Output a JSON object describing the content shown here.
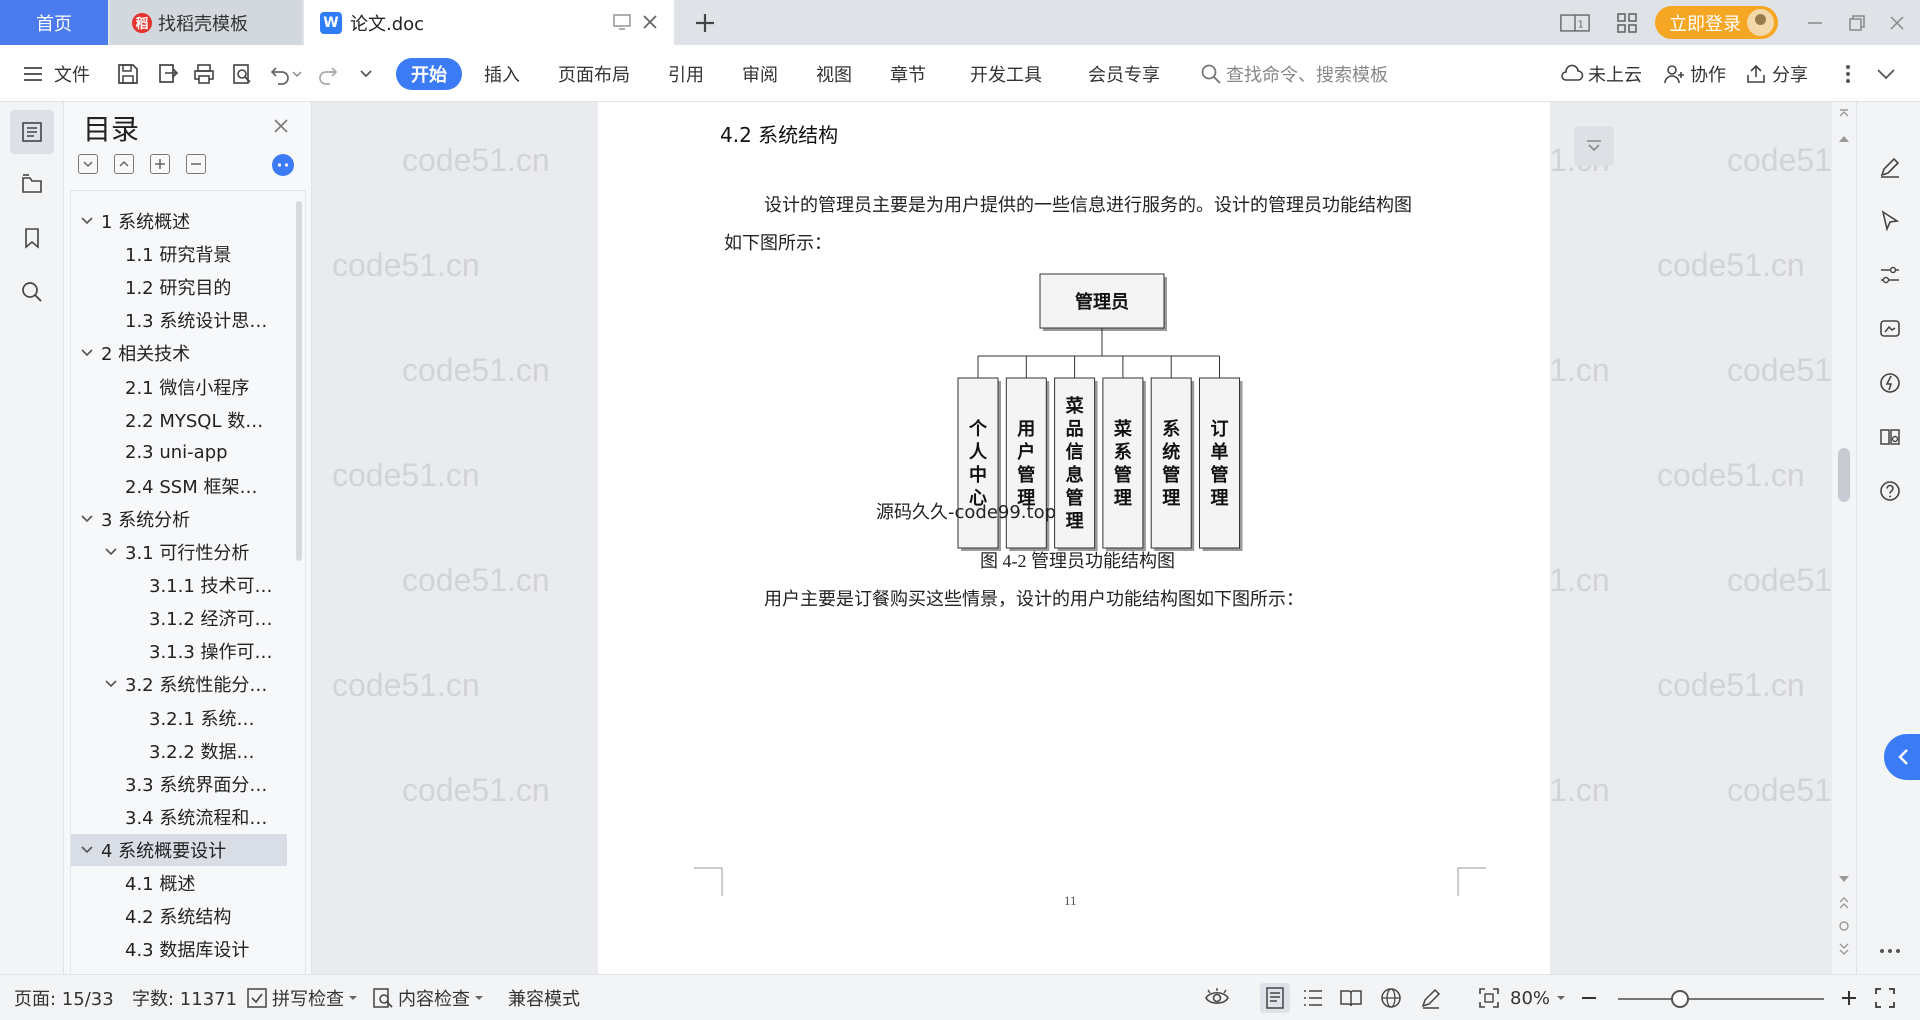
{
  "tabs": {
    "home": "首页",
    "template": "找稻壳模板",
    "doc": "论文.doc",
    "login": "立即登录"
  },
  "ribbon": {
    "file": "文件",
    "tabs": [
      "开始",
      "插入",
      "页面布局",
      "引用",
      "审阅",
      "视图",
      "章节",
      "开发工具",
      "会员专享"
    ],
    "search_placeholder": "查找命令、搜索模板",
    "cloud": "未上云",
    "collab": "协作",
    "share": "分享"
  },
  "toc": {
    "title": "目录",
    "items": [
      {
        "label": "1 系统概述",
        "level": 1,
        "expanded": true
      },
      {
        "label": "1.1  研究背景",
        "level": 2
      },
      {
        "label": "1.2 研究目的",
        "level": 2
      },
      {
        "label": "1.3 系统设计思…",
        "level": 2
      },
      {
        "label": "2 相关技术",
        "level": 1,
        "expanded": true
      },
      {
        "label": "2.1 微信小程序",
        "level": 2
      },
      {
        "label": "2.2 MYSQL 数…",
        "level": 2
      },
      {
        "label": "2.3 uni-app",
        "level": 2
      },
      {
        "label": "2.4 SSM 框架…",
        "level": 2
      },
      {
        "label": "3 系统分析",
        "level": 1,
        "expanded": true
      },
      {
        "label": "3.1 可行性分析",
        "level": 2,
        "expanded": true
      },
      {
        "label": "3.1.1 技术可…",
        "level": 3
      },
      {
        "label": "3.1.2 经济可…",
        "level": 3
      },
      {
        "label": "3.1.3 操作可…",
        "level": 3
      },
      {
        "label": "3.2 系统性能分…",
        "level": 2,
        "expanded": true
      },
      {
        "label": "3.2.1  系统…",
        "level": 3
      },
      {
        "label": "3.2.2  数据…",
        "level": 3
      },
      {
        "label": "3.3 系统界面分…",
        "level": 2
      },
      {
        "label": "3.4 系统流程和…",
        "level": 2
      },
      {
        "label": "4 系统概要设计",
        "level": 1,
        "expanded": true,
        "selected": true
      },
      {
        "label": "4.1 概述",
        "level": 2
      },
      {
        "label": "4.2 系统结构",
        "level": 2
      },
      {
        "label": "4.3 数据库设计",
        "level": 2
      }
    ]
  },
  "document": {
    "heading": "4.2 系统结构",
    "para1_line1": "设计的管理员主要是为用户提供的一些信息进行服务的。设计的管理员功能结构图",
    "para1_line2": "如下图所示：",
    "diagram_root": "管理员",
    "diagram_children": [
      "个人中心",
      "用户管理",
      "菜品信息管理",
      "菜系管理",
      "系统管理",
      "订单管理"
    ],
    "overlay_text": "源码久久-code99.top",
    "figure_caption": "图 4-2 管理员功能结构图",
    "para2": "用户主要是订餐购买这些情景，设计的用户功能结构图如下图所示：",
    "page_number": "11",
    "watermark": "code51.cn"
  },
  "status": {
    "page": "页面: 15/33",
    "words": "字数: 11371",
    "spell": "拼写检查",
    "content": "内容检查",
    "compat": "兼容模式",
    "zoom": "80%",
    "zoom_fraction": 0.3
  },
  "colors": {
    "accent": "#3c7bf6",
    "login": "#f5a623",
    "home_tab": "#4b7bec"
  }
}
